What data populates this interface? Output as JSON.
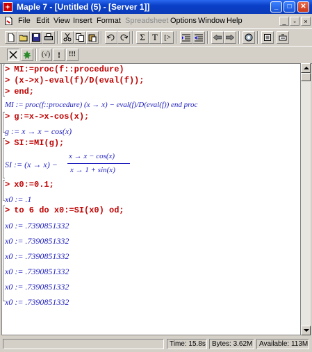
{
  "window": {
    "title": "Maple 7 - [Untitled (5) - [Server 1]]",
    "minimize_label": "_",
    "maximize_label": "□",
    "close_label": "✕"
  },
  "menu": {
    "items": [
      "File",
      "Edit",
      "View",
      "Insert",
      "Format",
      "Spreadsheet",
      "Options",
      "Window",
      "Help"
    ],
    "disabled_item": "Spreadsheet",
    "mdi_min": "_",
    "mdi_restore": "▫",
    "mdi_close": "×"
  },
  "toolbar": {
    "sigma_label": "Σ",
    "text_label": "T",
    "prompt_label": "[>",
    "icons": [
      "new-icon",
      "open-icon",
      "save-icon",
      "print-icon",
      "cut-icon",
      "copy-icon",
      "paste-icon",
      "undo-icon",
      "redo-icon",
      "sigma-icon",
      "text-icon",
      "prompt-icon",
      "indent-icon",
      "outdent-icon",
      "back-icon",
      "forward-icon",
      "restart-icon",
      "stop-icon",
      "help-icon"
    ]
  },
  "context_bar": {
    "sqrt_label": "(√)",
    "bang_label": "!",
    "multi_bang_label": "!!!"
  },
  "worksheet": {
    "prompt_symbol": ">",
    "inputs": [
      "MI:=proc(f::procedure)",
      "(x->x)-eval(f)/D(eval(f));",
      "end;",
      "g:=x->x-cos(x);",
      "SI:=MI(g);",
      "x0:=0.1;",
      "to 6 do x0:=SI(x0) od;"
    ],
    "out_proc": "MI := proc(f::procedure) (x → x) − eval(f)/D(eval(f)) end proc",
    "out_g": "g := x → x − cos(x)",
    "out_si_lhs": "SI := (x → x) −",
    "out_si_num": "x → x − cos(x)",
    "out_si_den": "x → 1 + sin(x)",
    "out_x0_initial": "x0 := .1",
    "out_x0_values": [
      "x0 := .7390851332",
      "x0 := .7390851332",
      "x0 := .7390851332",
      "x0 := .7390851332",
      "x0 := .7390851332",
      "x0 := .7390851332"
    ]
  },
  "status": {
    "time": "Time: 15.8s",
    "bytes": "Bytes: 3.62M",
    "available": "Available: 113M"
  },
  "colors": {
    "input": "#c00000",
    "output": "#2020c0",
    "titlebar": "#0a3fc8"
  }
}
